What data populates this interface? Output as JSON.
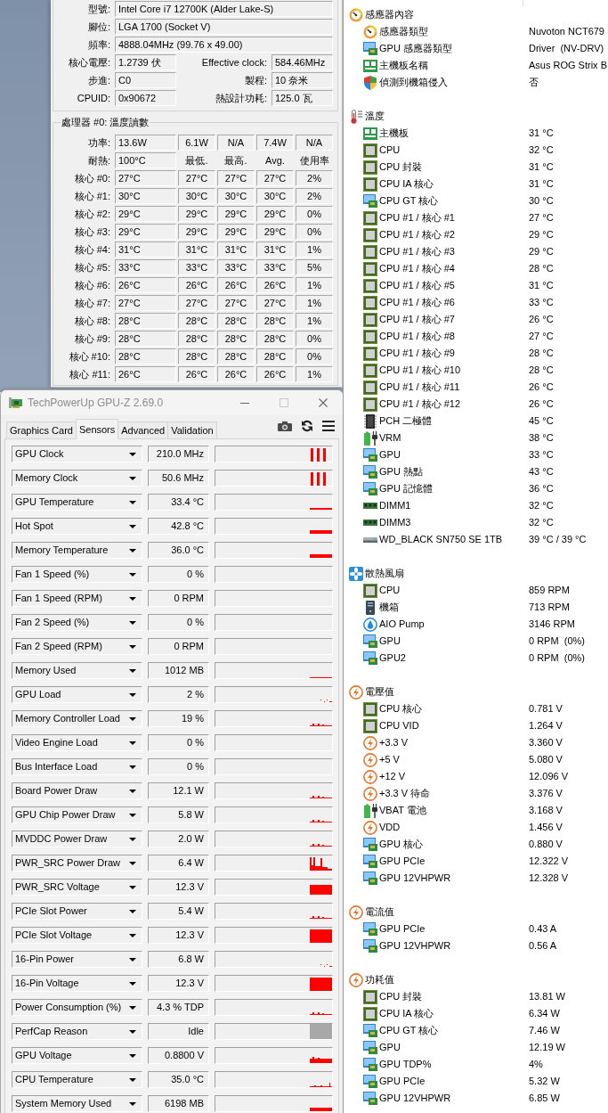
{
  "cpuz": {
    "info_rows": [
      {
        "fields": [
          {
            "label": "型號:",
            "value": "Intel Core i7 12700K (Alder Lake-S)"
          }
        ]
      },
      {
        "fields": [
          {
            "label": "腳位:",
            "value": "LGA 1700 (Socket V)"
          }
        ]
      },
      {
        "fields": [
          {
            "label": "頻率:",
            "value": "4888.04MHz (99.76 x 49.00)"
          }
        ]
      },
      {
        "fields": [
          {
            "label": "核心電壓:",
            "value": "1.2739 伏"
          },
          {
            "label": "Effective clock:",
            "value": "584.46MHz"
          }
        ]
      },
      {
        "fields": [
          {
            "label": "步進:",
            "value": "C0"
          },
          {
            "label": "製程:",
            "value": "10 奈米"
          }
        ]
      },
      {
        "fields": [
          {
            "label": "CPUID:",
            "value": "0x90672"
          },
          {
            "label": "熱設計功耗:",
            "value": "125.0 瓦"
          }
        ]
      }
    ],
    "temperature_group": {
      "title": "處理器 #0: 溫度讀數",
      "power": {
        "label": "功率:",
        "values": [
          "13.6W",
          "6.1W",
          "N/A",
          "7.4W",
          "N/A"
        ]
      },
      "tjmax": {
        "label": "耐熱:",
        "value": "100°C"
      },
      "column_headings": [
        "最低.",
        "最高.",
        "Avg.",
        "使用率"
      ],
      "cores": [
        {
          "label": "核心 #0:",
          "values": [
            "27°C",
            "27°C",
            "27°C",
            "27°C",
            "2%"
          ]
        },
        {
          "label": "核心 #1:",
          "values": [
            "30°C",
            "30°C",
            "30°C",
            "30°C",
            "2%"
          ]
        },
        {
          "label": "核心 #2:",
          "values": [
            "29°C",
            "29°C",
            "29°C",
            "29°C",
            "0%"
          ]
        },
        {
          "label": "核心 #3:",
          "values": [
            "29°C",
            "29°C",
            "29°C",
            "29°C",
            "0%"
          ]
        },
        {
          "label": "核心 #4:",
          "values": [
            "31°C",
            "31°C",
            "31°C",
            "31°C",
            "1%"
          ]
        },
        {
          "label": "核心 #5:",
          "values": [
            "33°C",
            "33°C",
            "33°C",
            "33°C",
            "5%"
          ]
        },
        {
          "label": "核心 #6:",
          "values": [
            "26°C",
            "26°C",
            "26°C",
            "26°C",
            "1%"
          ]
        },
        {
          "label": "核心 #7:",
          "values": [
            "27°C",
            "27°C",
            "27°C",
            "27°C",
            "1%"
          ]
        },
        {
          "label": "核心 #8:",
          "values": [
            "28°C",
            "28°C",
            "28°C",
            "28°C",
            "1%"
          ]
        },
        {
          "label": "核心 #9:",
          "values": [
            "28°C",
            "28°C",
            "28°C",
            "28°C",
            "0%"
          ]
        },
        {
          "label": "核心 #10:",
          "values": [
            "28°C",
            "28°C",
            "28°C",
            "28°C",
            "0%"
          ]
        },
        {
          "label": "核心 #11:",
          "values": [
            "26°C",
            "26°C",
            "26°C",
            "26°C",
            "1%"
          ]
        }
      ]
    }
  },
  "gpuz": {
    "title": "TechPowerUp GPU-Z 2.69.0",
    "title_buttons": [
      {
        "kind": "minimize",
        "disabled": false
      },
      {
        "kind": "maximize",
        "disabled": true
      },
      {
        "kind": "close",
        "disabled": false
      }
    ],
    "tabs": [
      {
        "label": "Graphics Card",
        "selected": false
      },
      {
        "label": "Sensors",
        "selected": true
      },
      {
        "label": "Advanced",
        "selected": false
      },
      {
        "label": "Validation",
        "selected": false
      }
    ],
    "sensors": [
      {
        "name": "GPU Clock",
        "value": "210.0 MHz",
        "kind": "spikes"
      },
      {
        "name": "Memory Clock",
        "value": "50.6 MHz",
        "kind": "spikes"
      },
      {
        "name": "GPU Temperature",
        "value": "33.4 °C",
        "kind": "line"
      },
      {
        "name": "Hot Spot",
        "value": "42.8 °C",
        "kind": "band"
      },
      {
        "name": "Memory Temperature",
        "value": "36.0 °C",
        "kind": "band"
      },
      {
        "name": "Fan 1 Speed (%)",
        "value": "0 %",
        "kind": "none"
      },
      {
        "name": "Fan 1 Speed (RPM)",
        "value": "0 RPM",
        "kind": "none"
      },
      {
        "name": "Fan 2 Speed (%)",
        "value": "0 %",
        "kind": "none"
      },
      {
        "name": "Fan 2 Speed (RPM)",
        "value": "0 RPM",
        "kind": "none"
      },
      {
        "name": "Memory Used",
        "value": "1012 MB",
        "kind": "hairline"
      },
      {
        "name": "GPU Load",
        "value": "2 %",
        "kind": "dots"
      },
      {
        "name": "Memory Controller Load",
        "value": "19 %",
        "kind": "bumps"
      },
      {
        "name": "Video Engine Load",
        "value": "0 %",
        "kind": "none"
      },
      {
        "name": "Bus Interface Load",
        "value": "0 %",
        "kind": "none"
      },
      {
        "name": "Board Power Draw",
        "value": "12.1 W",
        "kind": "bumps"
      },
      {
        "name": "GPU Chip Power Draw",
        "value": "5.8 W",
        "kind": "bumps"
      },
      {
        "name": "MVDDC Power Draw",
        "value": "2.0 W",
        "kind": "bumps"
      },
      {
        "name": "PWR_SRC Power Draw",
        "value": "6.4 W",
        "kind": "peaks"
      },
      {
        "name": "PWR_SRC Voltage",
        "value": "12.3 V",
        "kind": "slab"
      },
      {
        "name": "PCIe Slot Power",
        "value": "5.4 W",
        "kind": "bumps"
      },
      {
        "name": "PCIe Slot Voltage",
        "value": "12.3 V",
        "kind": "block"
      },
      {
        "name": "16-Pin Power",
        "value": "6.8 W",
        "kind": "dots"
      },
      {
        "name": "16-Pin Voltage",
        "value": "12.3 V",
        "kind": "block"
      },
      {
        "name": "Power Consumption (%)",
        "value": "4.3 % TDP",
        "kind": "bumps"
      },
      {
        "name": "PerfCap Reason",
        "value": "Idle",
        "kind": "idle"
      },
      {
        "name": "GPU Voltage",
        "value": "0.8800 V",
        "kind": "ridge"
      },
      {
        "name": "CPU Temperature",
        "value": "35.0 °C",
        "kind": "blip"
      },
      {
        "name": "System Memory Used",
        "value": "6198 MB",
        "kind": "band"
      }
    ]
  },
  "sensor_panel": {
    "sections": [
      {
        "title": "感應器內容",
        "kind": "gauge",
        "items": [
          {
            "label": "感應器類型",
            "value": "Nuvoton NCT679",
            "kind": "gauge"
          },
          {
            "label": "GPU 感應器類型",
            "value": "Driver  (NV-DRV)",
            "kind": "gpu"
          },
          {
            "label": "主機板名稱",
            "value": "Asus ROG Strix B",
            "kind": "board"
          },
          {
            "label": "偵測到機箱侵入",
            "value": "否",
            "kind": "shield"
          }
        ]
      },
      {
        "title": "溫度",
        "kind": "thermometer",
        "items": [
          {
            "label": "主機板",
            "value": "31 °C",
            "kind": "board"
          },
          {
            "label": "CPU",
            "value": "32 °C",
            "kind": "chip"
          },
          {
            "label": "CPU 封裝",
            "value": "31 °C",
            "kind": "chip"
          },
          {
            "label": "CPU IA 核心",
            "value": "31 °C",
            "kind": "chip"
          },
          {
            "label": "CPU GT 核心",
            "value": "30 °C",
            "kind": "gpu"
          },
          {
            "label": "CPU #1 / 核心 #1",
            "value": "27 °C",
            "kind": "chip"
          },
          {
            "label": "CPU #1 / 核心 #2",
            "value": "29 °C",
            "kind": "chip"
          },
          {
            "label": "CPU #1 / 核心 #3",
            "value": "29 °C",
            "kind": "chip"
          },
          {
            "label": "CPU #1 / 核心 #4",
            "value": "28 °C",
            "kind": "chip"
          },
          {
            "label": "CPU #1 / 核心 #5",
            "value": "31 °C",
            "kind": "chip"
          },
          {
            "label": "CPU #1 / 核心 #6",
            "value": "33 °C",
            "kind": "chip"
          },
          {
            "label": "CPU #1 / 核心 #7",
            "value": "26 °C",
            "kind": "chip"
          },
          {
            "label": "CPU #1 / 核心 #8",
            "value": "27 °C",
            "kind": "chip"
          },
          {
            "label": "CPU #1 / 核心 #9",
            "value": "28 °C",
            "kind": "chip"
          },
          {
            "label": "CPU #1 / 核心 #10",
            "value": "28 °C",
            "kind": "chip"
          },
          {
            "label": "CPU #1 / 核心 #11",
            "value": "26 °C",
            "kind": "chip"
          },
          {
            "label": "CPU #1 / 核心 #12",
            "value": "26 °C",
            "kind": "chip"
          },
          {
            "label": "PCH 二極體",
            "value": "45 °C",
            "kind": "pch"
          },
          {
            "label": "VRM",
            "value": "38 °C",
            "kind": "battery"
          },
          {
            "label": "GPU",
            "value": "33 °C",
            "kind": "gpu"
          },
          {
            "label": "GPU 熱點",
            "value": "43 °C",
            "kind": "gpu"
          },
          {
            "label": "GPU 記憶體",
            "value": "36 °C",
            "kind": "gpu"
          },
          {
            "label": "DIMM1",
            "value": "32 °C",
            "kind": "dimm"
          },
          {
            "label": "DIMM3",
            "value": "32 °C",
            "kind": "dimm"
          },
          {
            "label": "WD_BLACK SN750 SE 1TB",
            "value": "39 °C / 39 °C",
            "kind": "drive"
          }
        ]
      },
      {
        "title": "散熱風扇",
        "kind": "fan",
        "items": [
          {
            "label": "CPU",
            "value": "859 RPM",
            "kind": "chip"
          },
          {
            "label": "機箱",
            "value": "713 RPM",
            "kind": "case"
          },
          {
            "label": "AIO Pump",
            "value": "3146 RPM",
            "kind": "pump"
          },
          {
            "label": "GPU",
            "value": "0 RPM  (0%)",
            "kind": "gpu"
          },
          {
            "label": "GPU2",
            "value": "0 RPM  (0%)",
            "kind": "gpu"
          }
        ]
      },
      {
        "title": "電壓值",
        "kind": "bolt",
        "items": [
          {
            "label": "CPU 核心",
            "value": "0.781 V",
            "kind": "chip"
          },
          {
            "label": "CPU VID",
            "value": "1.264 V",
            "kind": "chip"
          },
          {
            "label": "+3.3 V",
            "value": "3.360 V",
            "kind": "bolt"
          },
          {
            "label": "+5 V",
            "value": "5.080 V",
            "kind": "bolt"
          },
          {
            "label": "+12 V",
            "value": "12.096 V",
            "kind": "bolt"
          },
          {
            "label": "+3.3 V 待命",
            "value": "3.376 V",
            "kind": "bolt"
          },
          {
            "label": "VBAT 電池",
            "value": "3.168 V",
            "kind": "battery"
          },
          {
            "label": "VDD",
            "value": "1.456 V",
            "kind": "bolt"
          },
          {
            "label": "GPU 核心",
            "value": "0.880 V",
            "kind": "gpu"
          },
          {
            "label": "GPU PCIe",
            "value": "12.322 V",
            "kind": "gpu"
          },
          {
            "label": "GPU 12VHPWR",
            "value": "12.328 V",
            "kind": "gpu"
          }
        ]
      },
      {
        "title": "電流值",
        "kind": "bolt",
        "items": [
          {
            "label": "GPU PCIe",
            "value": "0.43 A",
            "kind": "gpu"
          },
          {
            "label": "GPU 12VHPWR",
            "value": "0.56 A",
            "kind": "gpu"
          }
        ]
      },
      {
        "title": "功耗值",
        "kind": "bolt",
        "items": [
          {
            "label": "CPU 封裝",
            "value": "13.81 W",
            "kind": "chip"
          },
          {
            "label": "CPU IA 核心",
            "value": "6.34 W",
            "kind": "chip"
          },
          {
            "label": "CPU GT 核心",
            "value": "7.46 W",
            "kind": "gpu"
          },
          {
            "label": "GPU",
            "value": "12.19 W",
            "kind": "gpu"
          },
          {
            "label": "GPU TDP%",
            "value": "4%",
            "kind": "gpu"
          },
          {
            "label": "GPU PCIe",
            "value": "5.32 W",
            "kind": "gpu"
          },
          {
            "label": "GPU 12VHPWR",
            "value": "6.85 W",
            "kind": "gpu"
          }
        ]
      }
    ]
  }
}
